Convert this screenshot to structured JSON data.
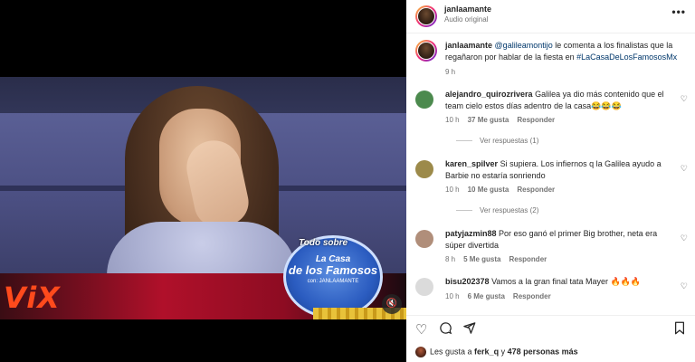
{
  "video": {
    "brand_logo": "ViX",
    "badge": {
      "top_text": "Todo sobre",
      "line1": "La Casa",
      "line2": "de los Famosos",
      "line3": "con: JANLAAMANTE"
    },
    "mute_icon": "speaker-muted-icon"
  },
  "header": {
    "username": "janlaamante",
    "audio": "Audio original",
    "more_icon": "•••"
  },
  "caption": {
    "username": "janlaamante",
    "mention": "@galileamontijo",
    "text": " le comenta a los finalistas que la regañaron por hablar de la fiesta en ",
    "hashtag": "#LaCasaDeLosFamososMx",
    "time": "9 h"
  },
  "comments": [
    {
      "username": "alejandro_quirozrivera",
      "text": "Galilea ya dio más contenido que el team cielo estos días adentro de la casa😂😂😂",
      "time": "10 h",
      "likes": "37 Me gusta",
      "reply": "Responder",
      "replies": "Ver respuestas (1)",
      "avatar_color": "#4c8a4e"
    },
    {
      "username": "karen_spilver",
      "text": "Si supiera. Los infiernos q la Galilea ayudo a Barbie no estaría sonriendo",
      "time": "10 h",
      "likes": "10 Me gusta",
      "reply": "Responder",
      "replies": "Ver respuestas (2)",
      "avatar_color": "#9c8a4a"
    },
    {
      "username": "patyjazmin88",
      "text": "Por eso ganó el primer Big brother, neta era súper divertida",
      "time": "8 h",
      "likes": "5 Me gusta",
      "reply": "Responder",
      "avatar_color": "#b08e7a"
    },
    {
      "username": "bisu202378",
      "text": "Vamos a la gran final tata Mayer 🔥🔥🔥",
      "time": "10 h",
      "likes": "6 Me gusta",
      "reply": "Responder",
      "avatar_color": "#dbdbdb"
    }
  ],
  "actions": {
    "heart_icon": "heart-icon",
    "comment_icon": "comment-icon",
    "share_icon": "share-icon",
    "save_icon": "bookmark-icon"
  },
  "likes": {
    "prefix": "Les gusta a ",
    "user": "ferk_q",
    "middle": " y ",
    "count": "478 personas más"
  }
}
